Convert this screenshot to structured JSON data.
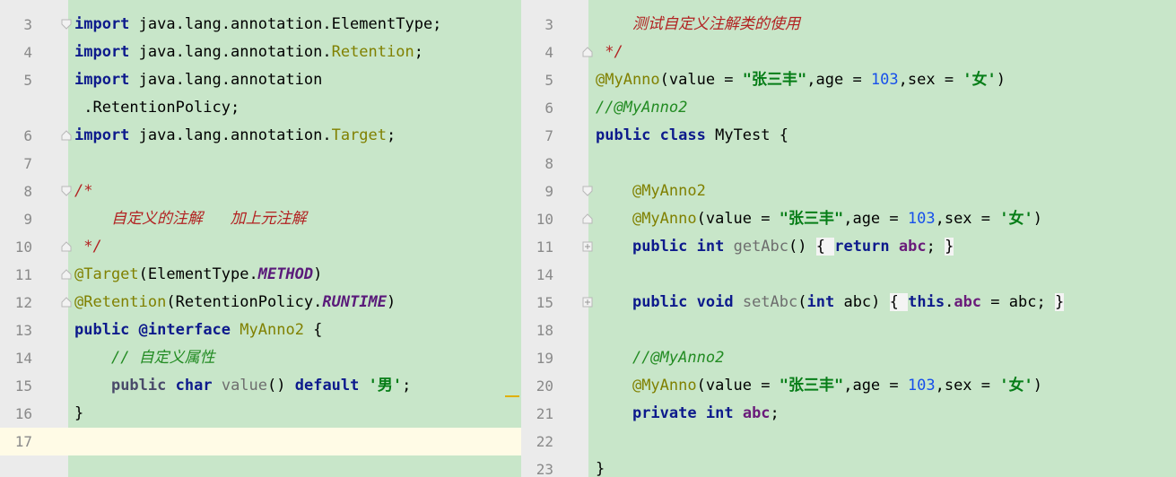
{
  "left_editor": {
    "lines": [
      {
        "num": "3",
        "mark": "fold",
        "tokens": [
          {
            "t": "import",
            "c": "kw"
          },
          {
            "t": " java.lang.annotation.ElementType;",
            "c": ""
          }
        ]
      },
      {
        "num": "4",
        "mark": "",
        "tokens": [
          {
            "t": "import",
            "c": "kw"
          },
          {
            "t": " java.lang.annotation.",
            "c": ""
          },
          {
            "t": "Retention",
            "c": "ann"
          },
          {
            "t": ";",
            "c": ""
          }
        ]
      },
      {
        "num": "5",
        "mark": "",
        "tokens": [
          {
            "t": "import",
            "c": "kw"
          },
          {
            "t": " java.lang.annotation",
            "c": ""
          }
        ]
      },
      {
        "num": "",
        "mark": "",
        "tokens": [
          {
            "t": " .RetentionPolicy;",
            "c": ""
          }
        ]
      },
      {
        "num": "6",
        "mark": "fold-end",
        "tokens": [
          {
            "t": "import",
            "c": "kw"
          },
          {
            "t": " java.lang.annotation.",
            "c": ""
          },
          {
            "t": "Target",
            "c": "ann"
          },
          {
            "t": ";",
            "c": ""
          }
        ]
      },
      {
        "num": "7",
        "mark": "",
        "tokens": []
      },
      {
        "num": "8",
        "mark": "fold",
        "tokens": [
          {
            "t": "/*",
            "c": "cm"
          }
        ]
      },
      {
        "num": "9",
        "mark": "",
        "tokens": [
          {
            "t": "    自定义的注解   加上元注解",
            "c": "cm"
          }
        ]
      },
      {
        "num": "10",
        "mark": "fold-end",
        "tokens": [
          {
            "t": " */",
            "c": "cm"
          }
        ]
      },
      {
        "num": "11",
        "mark": "fold-end",
        "tokens": [
          {
            "t": "@Target",
            "c": "ann"
          },
          {
            "t": "(ElementType.",
            "c": ""
          },
          {
            "t": "METHOD",
            "c": "italic-c"
          },
          {
            "t": ")",
            "c": ""
          }
        ]
      },
      {
        "num": "12",
        "mark": "fold-end",
        "tokens": [
          {
            "t": "@Retention",
            "c": "ann"
          },
          {
            "t": "(RetentionPolicy.",
            "c": ""
          },
          {
            "t": "RUNTIME",
            "c": "italic-c"
          },
          {
            "t": ")",
            "c": ""
          }
        ]
      },
      {
        "num": "13",
        "mark": "",
        "tokens": [
          {
            "t": "public",
            "c": "kw"
          },
          {
            "t": " ",
            "c": ""
          },
          {
            "t": "@interface",
            "c": "kw"
          },
          {
            "t": " ",
            "c": ""
          },
          {
            "t": "MyAnno2",
            "c": "ann"
          },
          {
            "t": " {",
            "c": ""
          }
        ]
      },
      {
        "num": "14",
        "mark": "",
        "tokens": [
          {
            "t": "    ",
            "c": ""
          },
          {
            "t": "// 自定义属性",
            "c": "lc"
          }
        ]
      },
      {
        "num": "15",
        "mark": "",
        "tokens": [
          {
            "t": "    ",
            "c": ""
          },
          {
            "t": "public",
            "c": "greykw"
          },
          {
            "t": " ",
            "c": ""
          },
          {
            "t": "char",
            "c": "kw"
          },
          {
            "t": " ",
            "c": ""
          },
          {
            "t": "value",
            "c": "greyc"
          },
          {
            "t": "() ",
            "c": ""
          },
          {
            "t": "default",
            "c": "kw"
          },
          {
            "t": " ",
            "c": ""
          },
          {
            "t": "'男'",
            "c": "chr"
          },
          {
            "t": ";",
            "c": ""
          }
        ]
      },
      {
        "num": "16",
        "mark": "",
        "tokens": [
          {
            "t": "}",
            "c": ""
          }
        ]
      },
      {
        "num": "17",
        "mark": "",
        "tokens": [],
        "current": true
      }
    ]
  },
  "right_editor": {
    "lines": [
      {
        "num": "3",
        "mark": "",
        "tokens": [
          {
            "t": "    测试自定义注解类的使用",
            "c": "cm"
          }
        ]
      },
      {
        "num": "4",
        "mark": "fold-end",
        "tokens": [
          {
            "t": " */",
            "c": "cm"
          }
        ]
      },
      {
        "num": "5",
        "mark": "",
        "tokens": [
          {
            "t": "@MyAnno",
            "c": "ann"
          },
          {
            "t": "(value = ",
            "c": ""
          },
          {
            "t": "\"张三丰\"",
            "c": "str"
          },
          {
            "t": ",age = ",
            "c": ""
          },
          {
            "t": "103",
            "c": "numv"
          },
          {
            "t": ",sex = ",
            "c": ""
          },
          {
            "t": "'女'",
            "c": "chr"
          },
          {
            "t": ")",
            "c": ""
          }
        ]
      },
      {
        "num": "6",
        "mark": "",
        "tokens": [
          {
            "t": "//@MyAnno2",
            "c": "lc"
          }
        ]
      },
      {
        "num": "7",
        "mark": "",
        "tokens": [
          {
            "t": "public",
            "c": "kw"
          },
          {
            "t": " ",
            "c": ""
          },
          {
            "t": "class",
            "c": "kw"
          },
          {
            "t": " MyTest {",
            "c": ""
          }
        ]
      },
      {
        "num": "8",
        "mark": "",
        "tokens": []
      },
      {
        "num": "9",
        "mark": "fold",
        "tokens": [
          {
            "t": "    ",
            "c": ""
          },
          {
            "t": "@MyAnno2",
            "c": "ann"
          }
        ]
      },
      {
        "num": "10",
        "mark": "fold-end",
        "tokens": [
          {
            "t": "    ",
            "c": ""
          },
          {
            "t": "@MyAnno",
            "c": "ann"
          },
          {
            "t": "(value = ",
            "c": ""
          },
          {
            "t": "\"张三丰\"",
            "c": "str"
          },
          {
            "t": ",age = ",
            "c": ""
          },
          {
            "t": "103",
            "c": "numv"
          },
          {
            "t": ",sex = ",
            "c": ""
          },
          {
            "t": "'女'",
            "c": "chr"
          },
          {
            "t": ")",
            "c": ""
          }
        ]
      },
      {
        "num": "11",
        "mark": "expand",
        "tokens": [
          {
            "t": "    ",
            "c": ""
          },
          {
            "t": "public",
            "c": "kw"
          },
          {
            "t": " ",
            "c": ""
          },
          {
            "t": "int",
            "c": "kw"
          },
          {
            "t": " ",
            "c": ""
          },
          {
            "t": "getAbc",
            "c": "greyc"
          },
          {
            "t": "() ",
            "c": ""
          },
          {
            "t": "{ ",
            "c": "fold"
          },
          {
            "t": "return",
            "c": "kw"
          },
          {
            "t": " ",
            "c": ""
          },
          {
            "t": "abc",
            "c": "fld"
          },
          {
            "t": "; ",
            "c": ""
          },
          {
            "t": "}",
            "c": "fold"
          }
        ]
      },
      {
        "num": "14",
        "mark": "",
        "tokens": []
      },
      {
        "num": "15",
        "mark": "expand",
        "tokens": [
          {
            "t": "    ",
            "c": ""
          },
          {
            "t": "public",
            "c": "kw"
          },
          {
            "t": " ",
            "c": ""
          },
          {
            "t": "void",
            "c": "kw"
          },
          {
            "t": " ",
            "c": ""
          },
          {
            "t": "setAbc",
            "c": "greyc"
          },
          {
            "t": "(",
            "c": ""
          },
          {
            "t": "int",
            "c": "kw"
          },
          {
            "t": " abc) ",
            "c": ""
          },
          {
            "t": "{ ",
            "c": "fold"
          },
          {
            "t": "this",
            "c": "kw"
          },
          {
            "t": ".",
            "c": ""
          },
          {
            "t": "abc",
            "c": "fld"
          },
          {
            "t": " = abc; ",
            "c": ""
          },
          {
            "t": "}",
            "c": "fold"
          }
        ]
      },
      {
        "num": "18",
        "mark": "",
        "tokens": []
      },
      {
        "num": "19",
        "mark": "",
        "tokens": [
          {
            "t": "    ",
            "c": ""
          },
          {
            "t": "//@MyAnno2",
            "c": "lc"
          }
        ]
      },
      {
        "num": "20",
        "mark": "",
        "tokens": [
          {
            "t": "    ",
            "c": ""
          },
          {
            "t": "@MyAnno",
            "c": "ann"
          },
          {
            "t": "(value = ",
            "c": ""
          },
          {
            "t": "\"张三丰\"",
            "c": "str"
          },
          {
            "t": ",age = ",
            "c": ""
          },
          {
            "t": "103",
            "c": "numv"
          },
          {
            "t": ",sex = ",
            "c": ""
          },
          {
            "t": "'女'",
            "c": "chr"
          },
          {
            "t": ")",
            "c": ""
          }
        ]
      },
      {
        "num": "21",
        "mark": "",
        "tokens": [
          {
            "t": "    ",
            "c": ""
          },
          {
            "t": "private",
            "c": "kw"
          },
          {
            "t": " ",
            "c": ""
          },
          {
            "t": "int",
            "c": "kw"
          },
          {
            "t": " ",
            "c": ""
          },
          {
            "t": "abc",
            "c": "fld"
          },
          {
            "t": ";",
            "c": ""
          }
        ]
      },
      {
        "num": "22",
        "mark": "",
        "tokens": []
      },
      {
        "num": "23",
        "mark": "",
        "tokens": [
          {
            "t": "}",
            "c": ""
          }
        ]
      }
    ]
  }
}
